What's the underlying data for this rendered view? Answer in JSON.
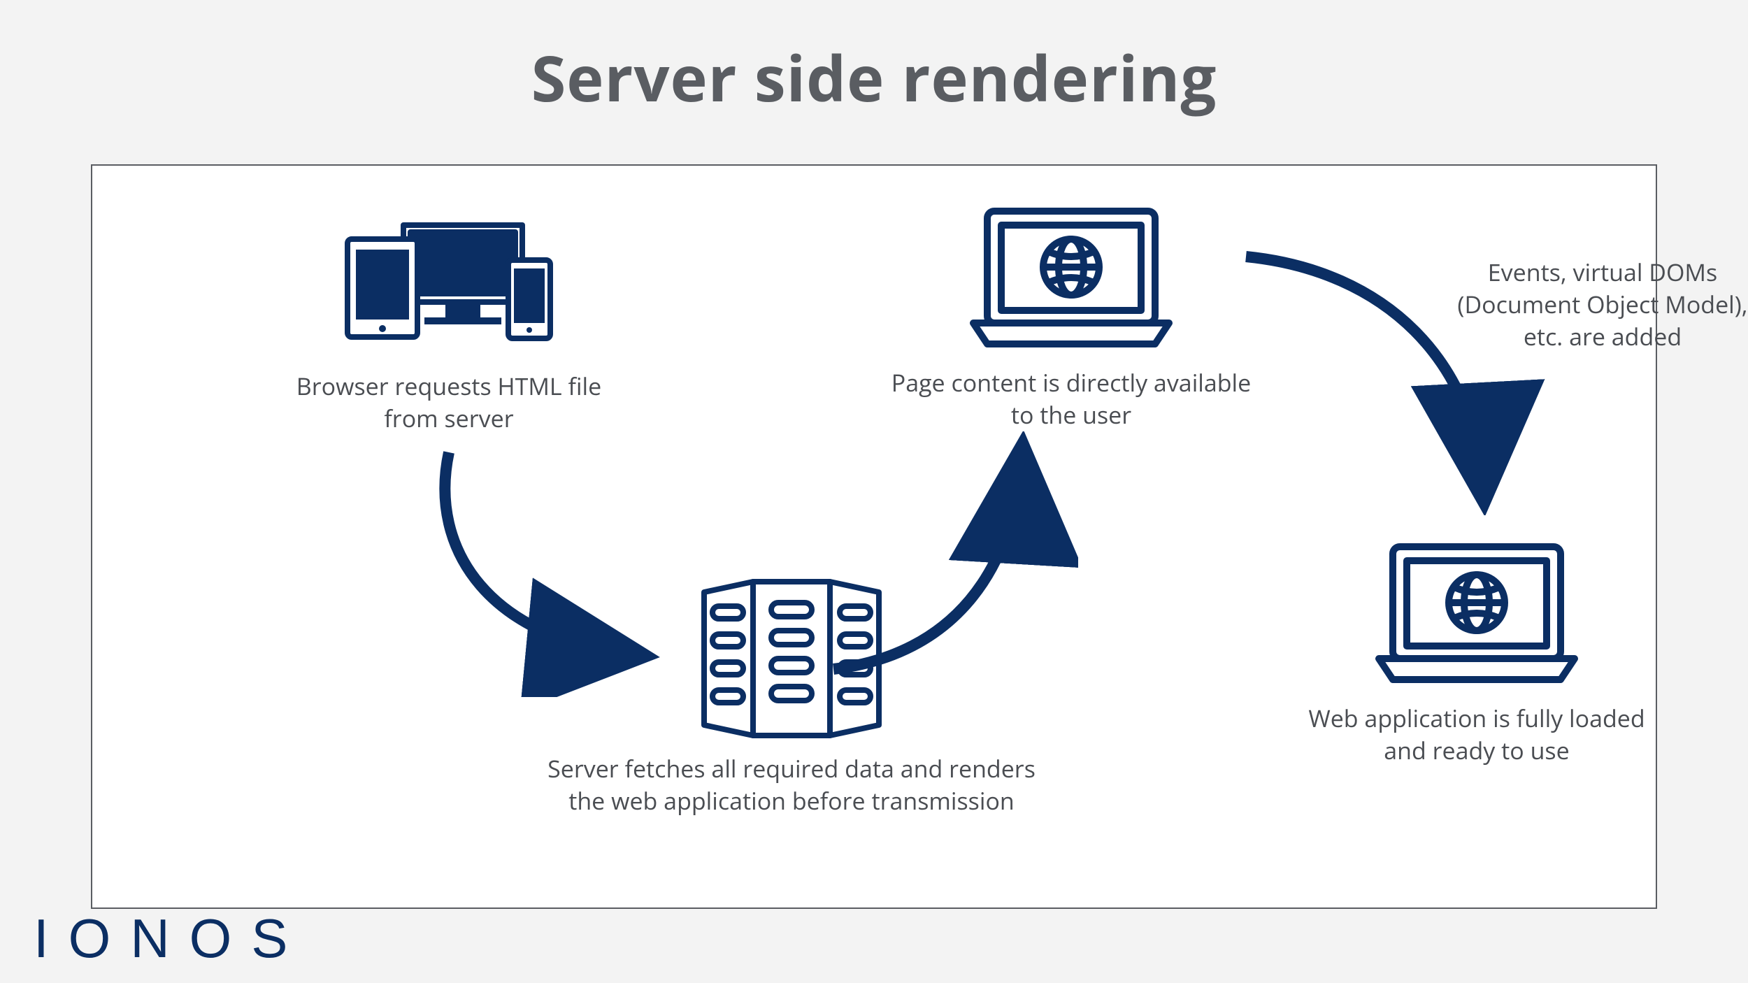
{
  "title": "Server side rendering",
  "colors": {
    "accent": "#0b2e63",
    "text": "#4a4d52",
    "title": "#5a5d62"
  },
  "brand": "IONOS",
  "steps": {
    "browser": {
      "caption": "Browser requests HTML file from server",
      "icon": "devices-icon"
    },
    "server": {
      "caption": "Server fetches all required data and renders the web application before transmission",
      "icon": "server-rack-icon"
    },
    "page": {
      "caption": "Page content is directly available to the user",
      "icon": "laptop-globe-icon"
    },
    "loaded": {
      "caption": "Web application is fully loaded and ready to use",
      "icon": "laptop-globe-icon"
    }
  },
  "arrowLabel": "Events, virtual DOMs (Document Object Model), etc. are added"
}
